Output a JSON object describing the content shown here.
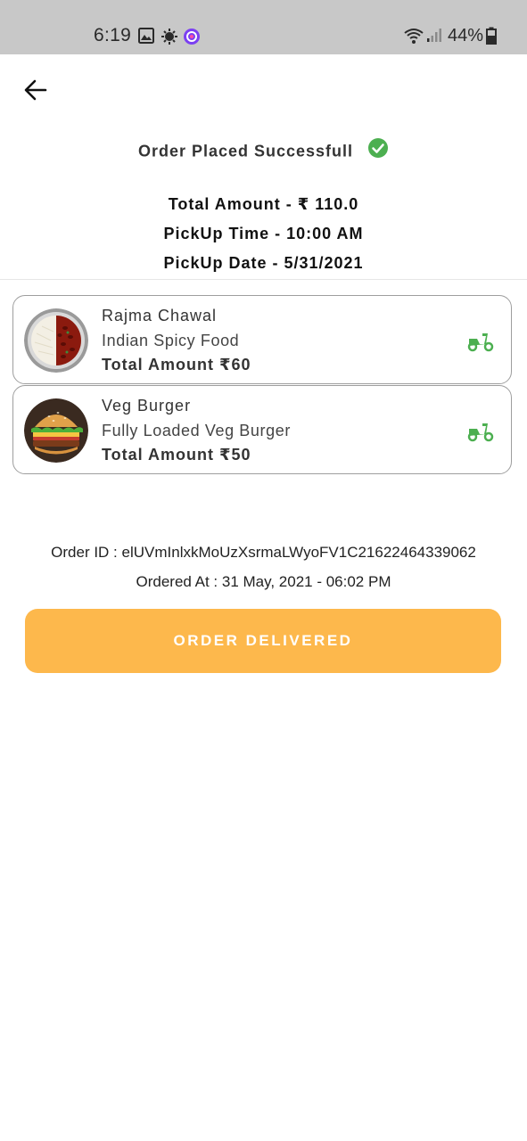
{
  "status_bar": {
    "time": "6:19",
    "battery": "44%"
  },
  "header": {
    "success_text": "Order Placed Successfull",
    "total_amount": "Total Amount - ₹ 110.0",
    "pickup_time": "PickUp Time - 10:00 AM",
    "pickup_date": "PickUp Date - 5/31/2021"
  },
  "items": [
    {
      "name": "Rajma Chawal",
      "description": "Indian Spicy Food",
      "amount": "Total Amount ₹60",
      "icon": "scooter-icon"
    },
    {
      "name": "Veg Burger",
      "description": "Fully Loaded Veg Burger",
      "amount": "Total Amount ₹50",
      "icon": "scooter-icon"
    }
  ],
  "order": {
    "id_text": "Order ID : elUVmInlxkMoUzXsrmaLWyoFV1C21622464339062",
    "ordered_at": "Ordered At : 31 May, 2021 - 06:02 PM"
  },
  "action": {
    "button_label": "ORDER DELIVERED"
  },
  "colors": {
    "accent_button": "#fdb84c",
    "success_green": "#4caf50",
    "status_bar_bg": "#c8c8c8"
  }
}
